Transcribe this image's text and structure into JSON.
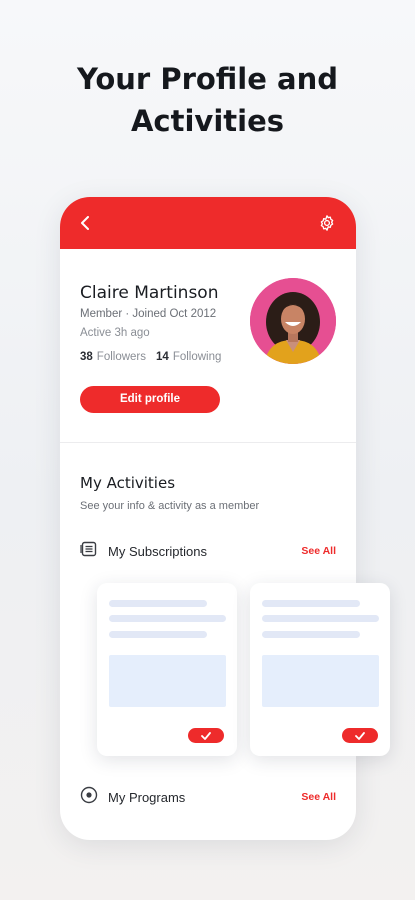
{
  "headline": {
    "line1": "Your Profile and",
    "line2": "Activities"
  },
  "topbar": {
    "back_icon": "chevron-left-icon",
    "settings_icon": "gear-icon",
    "color": "#ee2b2b"
  },
  "profile": {
    "name": "Claire Martinson",
    "meta": "Member · Joined Oct 2012",
    "active": "Active 3h ago",
    "followers_count": "38",
    "followers_label": "Followers",
    "following_count": "14",
    "following_label": "Following",
    "edit_label": "Edit profile"
  },
  "activities": {
    "title": "My Activities",
    "subtitle": "See your info & activity as a member",
    "subscriptions": {
      "label": "My Subscriptions",
      "see_all": "See All",
      "icon": "list-icon"
    },
    "programs": {
      "label": "My Programs",
      "see_all": "See All",
      "icon": "play-circle-icon"
    }
  },
  "accent_color": "#ee2b2b"
}
